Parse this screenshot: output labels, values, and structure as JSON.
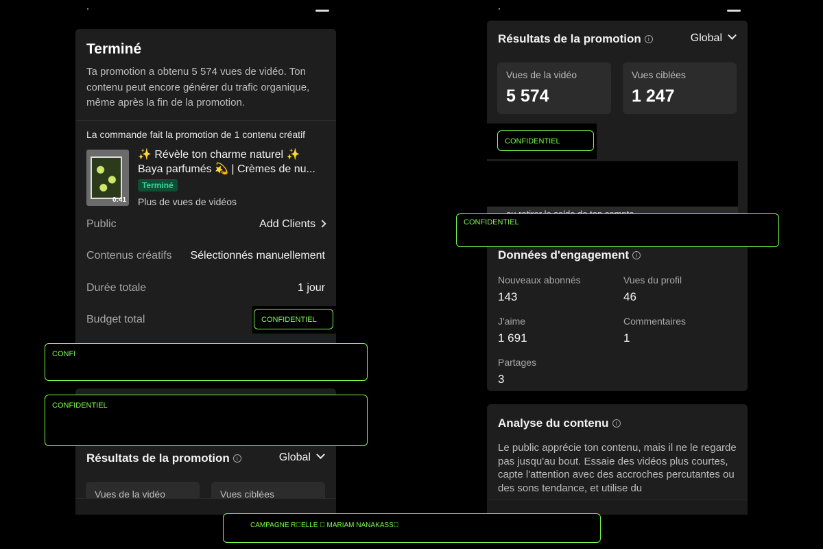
{
  "left": {
    "summary": {
      "title": "Terminé",
      "description": "Ta promotion a obtenu 5 574 vues de vidéo. Ton contenu peut encore générer du trafic organique, même après la fin de la promotion."
    },
    "order": {
      "label": "La commande fait la promotion de 1 contenu créatif",
      "video_title_line1": "✨ Révèle ton charme naturel ✨",
      "video_title_line2": "Baya parfumés 💫 | Crèmes de nu...",
      "duration": "0:41",
      "status": "Terminé",
      "goal": "Plus de vues de vidéos"
    },
    "details": [
      {
        "label": "Public",
        "value": "Add Clients"
      },
      {
        "label": "Contenus créatifs",
        "value": "Sélectionnés manuellement"
      },
      {
        "label": "Durée totale",
        "value": "1 jour"
      },
      {
        "label": "Budget total",
        "value": ""
      }
    ],
    "results": {
      "title": "Résultats de la promotion",
      "filter": "Global",
      "metrics": [
        {
          "label": "Vues de la vidéo"
        },
        {
          "label": "Vues ciblées"
        }
      ]
    }
  },
  "right": {
    "results": {
      "title": "Résultats de la promotion",
      "filter": "Global",
      "metrics": [
        {
          "label": "Vues de la vidéo",
          "value": "5 574"
        },
        {
          "label": "Vues ciblées",
          "value": "1 247"
        }
      ],
      "overflow_text": "ou retirer le solde de ton compte"
    },
    "engagement": {
      "title": "Données d'engagement",
      "items": [
        {
          "label": "Nouveaux abonnés",
          "value": "143"
        },
        {
          "label": "Vues du profil",
          "value": "46"
        },
        {
          "label": "J'aime",
          "value": "1 691"
        },
        {
          "label": "Commentaires",
          "value": "1"
        },
        {
          "label": "Partages",
          "value": "3"
        }
      ]
    },
    "analysis": {
      "title": "Analyse du contenu",
      "body": "Le public apprécie ton contenu, mais il ne le regarde pas jusqu'au bout. Essaie des vidéos plus courtes, capte l'attention avec des accroches percutantes ou des sons tendance, et utilise du"
    }
  },
  "redactions": {
    "confidential": "CONFIDENTIEL",
    "confidential_cut": "CONFI",
    "campaign": "CAMPAGNE R\u0000ELLE \u0000 MARIAM NANAKASS\u0000"
  },
  "colors": {
    "background": "#000000",
    "card": "#1e1e1e",
    "metric_box": "#2c2c2c",
    "status_green": "#2fd99b",
    "redaction_green": "#7dfd4a"
  }
}
